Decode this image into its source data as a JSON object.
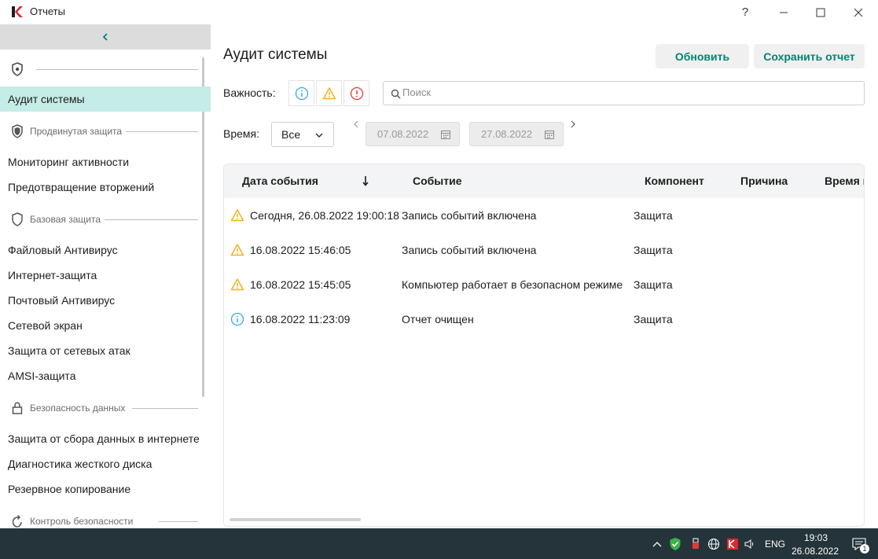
{
  "window": {
    "title": "Отчеты",
    "help_label": "?",
    "minimize_label": "—",
    "maximize_label": "☐",
    "close_label": "✕"
  },
  "sidebar": {
    "sections": [
      {
        "label": "",
        "icon": "shield-icon"
      },
      {
        "label": "Продвинутая защита",
        "icon": "shield-advanced-icon"
      },
      {
        "label": "Базовая защита",
        "icon": "shield-outline-icon"
      },
      {
        "label": "Безопасность данных",
        "icon": "lock-icon"
      },
      {
        "label": "Контроль безопасности",
        "icon": "refresh-shield-icon"
      }
    ],
    "items": [
      {
        "label": "Аудит системы",
        "active": true
      },
      {
        "label": "Мониторинг активности"
      },
      {
        "label": "Предотвращение вторжений"
      },
      {
        "label": "Файловый Антивирус"
      },
      {
        "label": "Интернет-защита"
      },
      {
        "label": "Почтовый Антивирус"
      },
      {
        "label": "Сетевой экран"
      },
      {
        "label": "Защита от сетевых атак"
      },
      {
        "label": "AMSI-защита"
      },
      {
        "label": "Защита от сбора данных в интернете"
      },
      {
        "label": "Диагностика жесткого диска"
      },
      {
        "label": "Резервное копирование"
      }
    ]
  },
  "main": {
    "title": "Аудит системы",
    "refresh_label": "Обновить",
    "save_label": "Сохранить отчет",
    "severity_label": "Важность:",
    "search_placeholder": "Поиск",
    "time_label": "Время:",
    "time_select_value": "Все",
    "date_from": "07.08.2022",
    "date_to": "27.08.2022"
  },
  "table": {
    "columns": [
      "Дата события",
      "Событие",
      "Компонент",
      "Причина",
      "Время в"
    ],
    "sort_icon": "arrow-down-icon",
    "rows": [
      {
        "severity": "warning",
        "date": "Сегодня, 26.08.2022 19:00:18",
        "event": "Запись событий включена",
        "component": "Защита"
      },
      {
        "severity": "warning",
        "date": "16.08.2022 15:46:05",
        "event": "Запись событий включена",
        "component": "Защита"
      },
      {
        "severity": "warning",
        "date": "16.08.2022 15:45:05",
        "event": "Компьютер работает в безопасном режиме",
        "component": "Защита"
      },
      {
        "severity": "info",
        "date": "16.08.2022 11:23:09",
        "event": "Отчет очищен",
        "component": "Защита"
      }
    ]
  },
  "taskbar": {
    "lang": "ENG",
    "time": "19:03",
    "date": "26.08.2022",
    "notification_count": "1"
  },
  "colors": {
    "accent": "#00856f",
    "active_item": "#c5ece6",
    "warning": "#f2b01e",
    "info": "#3ba8e0",
    "critical": "#e53935",
    "taskbar": "#24343a"
  }
}
